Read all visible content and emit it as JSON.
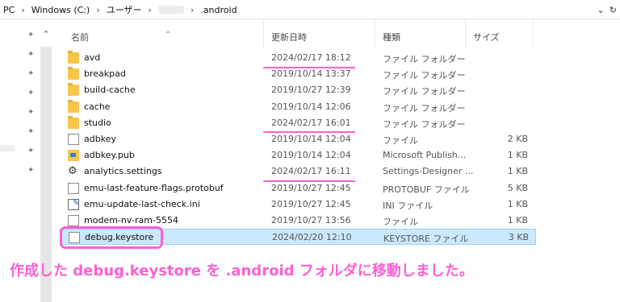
{
  "address": {
    "crumbs": [
      "PC",
      "Windows (C:)",
      "ユーザー",
      ".android"
    ],
    "dropdown_icon": "chevron-down-icon",
    "refresh_icon": "refresh-icon"
  },
  "columns": {
    "name": "名前",
    "date": "更新日時",
    "type": "種類",
    "size": "サイズ"
  },
  "files": [
    {
      "name": "avd",
      "date": "2024/02/17 18:12",
      "type": "ファイル フォルダー",
      "size": "",
      "icon": "folder-icon"
    },
    {
      "name": "breakpad",
      "date": "2019/10/14 13:37",
      "type": "ファイル フォルダー",
      "size": "",
      "icon": "folder-icon"
    },
    {
      "name": "build-cache",
      "date": "2019/10/27 12:39",
      "type": "ファイル フォルダー",
      "size": "",
      "icon": "folder-icon"
    },
    {
      "name": "cache",
      "date": "2019/10/14 12:06",
      "type": "ファイル フォルダー",
      "size": "",
      "icon": "folder-icon"
    },
    {
      "name": "studio",
      "date": "2024/02/17 16:01",
      "type": "ファイル フォルダー",
      "size": "",
      "icon": "folder-icon"
    },
    {
      "name": "adbkey",
      "date": "2019/10/14 12:04",
      "type": "ファイル",
      "size": "2 KB",
      "icon": "file-icon"
    },
    {
      "name": "adbkey.pub",
      "date": "2019/10/14 12:04",
      "type": "Microsoft Publish...",
      "size": "1 KB",
      "icon": "publisher-icon"
    },
    {
      "name": "analytics.settings",
      "date": "2024/02/17 16:11",
      "type": "Settings-Designer ...",
      "size": "1 KB",
      "icon": "gear-icon"
    },
    {
      "name": "emu-last-feature-flags.protobuf",
      "date": "2019/10/27 12:45",
      "type": "PROTOBUF ファイル",
      "size": "5 KB",
      "icon": "file-icon"
    },
    {
      "name": "emu-update-last-check.ini",
      "date": "2019/10/27 12:45",
      "type": "INI ファイル",
      "size": "1 KB",
      "icon": "ini-icon"
    },
    {
      "name": "modem-nv-ram-5554",
      "date": "2019/10/27 13:56",
      "type": "ファイル",
      "size": "1 KB",
      "icon": "file-icon"
    },
    {
      "name": "debug.keystore",
      "date": "2024/02/20 12:10",
      "type": "KEYSTORE ファイル",
      "size": "3 KB",
      "icon": "file-icon"
    }
  ],
  "annotation": {
    "caption": "作成した debug.keystore を .android フォルダに移動しました。",
    "color": "#ff5fd2"
  },
  "colors": {
    "selection": "#cce8ff",
    "folder": "#f7c64a"
  }
}
